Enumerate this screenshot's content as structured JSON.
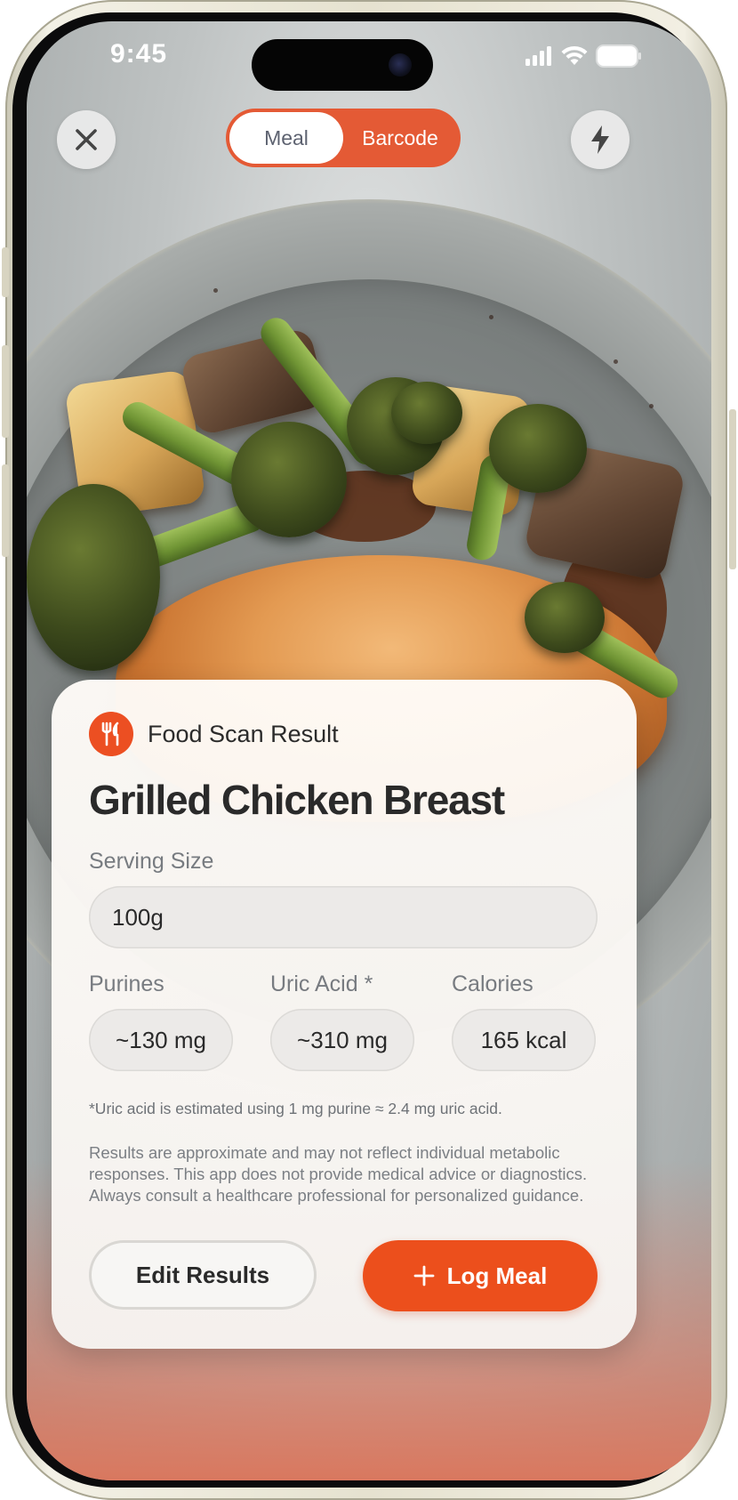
{
  "status_bar": {
    "time": "9:45"
  },
  "camera_controls": {
    "close_icon": "close-icon",
    "flash_icon": "lightning-bolt-icon",
    "modes": [
      {
        "label": "Meal",
        "active": true
      },
      {
        "label": "Barcode",
        "active": false
      }
    ]
  },
  "result_card": {
    "header_icon": "fork-knife-icon",
    "header_label": "Food Scan Result",
    "food_name": "Grilled Chicken Breast",
    "serving_size_label": "Serving Size",
    "serving_size_value": "100g",
    "metrics": [
      {
        "label": "Purines",
        "value": "~130 mg"
      },
      {
        "label": "Uric Acid *",
        "value": "~310 mg"
      },
      {
        "label": "Calories",
        "value": "165 kcal"
      }
    ],
    "footnote": "*Uric acid is estimated using 1 mg purine ≈ 2.4 mg uric acid.",
    "disclaimer": "Results are approximate and may not reflect individual metabolic responses. This app does not provide medical advice or diagnostics. Always consult a healthcare professional for personalized guidance.",
    "edit_button_label": "Edit Results",
    "log_button_label": "Log Meal",
    "log_button_icon": "plus-icon"
  },
  "colors": {
    "accent": "#EC4F1C",
    "segment_bg": "#E45A35",
    "phone_frame": "#E6E2D0"
  }
}
